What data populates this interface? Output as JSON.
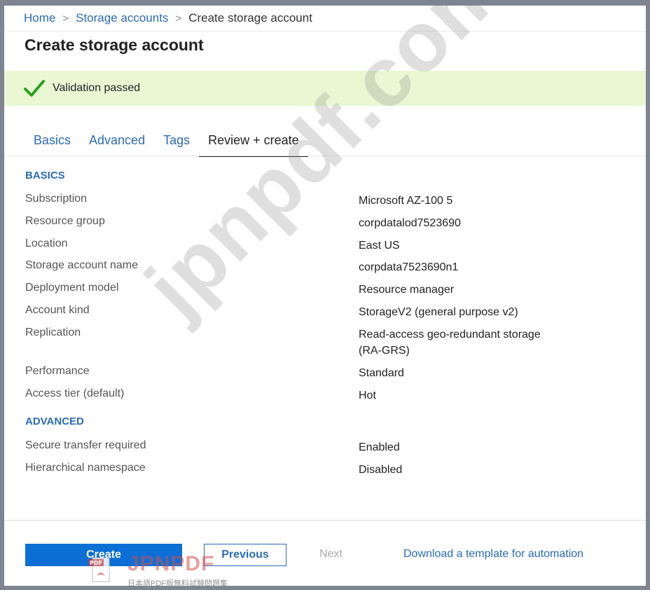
{
  "breadcrumb": {
    "home": "Home",
    "storage_accounts": "Storage accounts",
    "current": "Create storage account",
    "separator": ">"
  },
  "page": {
    "title": "Create storage account"
  },
  "validation": {
    "message": "Validation passed",
    "color": "#2e9e1f"
  },
  "tabs": [
    {
      "label": "Basics"
    },
    {
      "label": "Advanced"
    },
    {
      "label": "Tags"
    },
    {
      "label": "Review + create"
    }
  ],
  "basics": {
    "heading": "BASICS",
    "rows": [
      {
        "label": "Subscription",
        "value": "Microsoft AZ-100 5"
      },
      {
        "label": "Resource group",
        "value": "corpdatalod7523690"
      },
      {
        "label": "Location",
        "value": "East US"
      },
      {
        "label": "Storage account name",
        "value": "corpdata7523690n1"
      },
      {
        "label": "Deployment model",
        "value": "Resource manager"
      },
      {
        "label": "Account kind",
        "value": "StorageV2 (general purpose v2)"
      },
      {
        "label": "Replication",
        "value": "Read-access geo-redundant storage",
        "value2": "(RA-GRS)"
      },
      {
        "label": "Performance",
        "value": "Standard"
      },
      {
        "label": "Access tier (default)",
        "value": "Hot"
      }
    ]
  },
  "advanced": {
    "heading": "ADVANCED",
    "rows": [
      {
        "label": "Secure transfer required",
        "value": "Enabled"
      },
      {
        "label": "Hierarchical namespace",
        "value": "Disabled"
      }
    ]
  },
  "footer": {
    "create_label": "Create",
    "previous_label": "Previous",
    "next_label": "Next",
    "download_label": "Download a template for automation"
  },
  "watermark": {
    "text": "jpnpdf.com",
    "brand": "JPNPDF",
    "pdf_badge": "PDF",
    "tagline": "日本語PDF版無料試験問題集"
  },
  "colors": {
    "link": "#2b6bb8",
    "banner": "#e9f8d3",
    "primary_button": "#0b6fd6"
  }
}
